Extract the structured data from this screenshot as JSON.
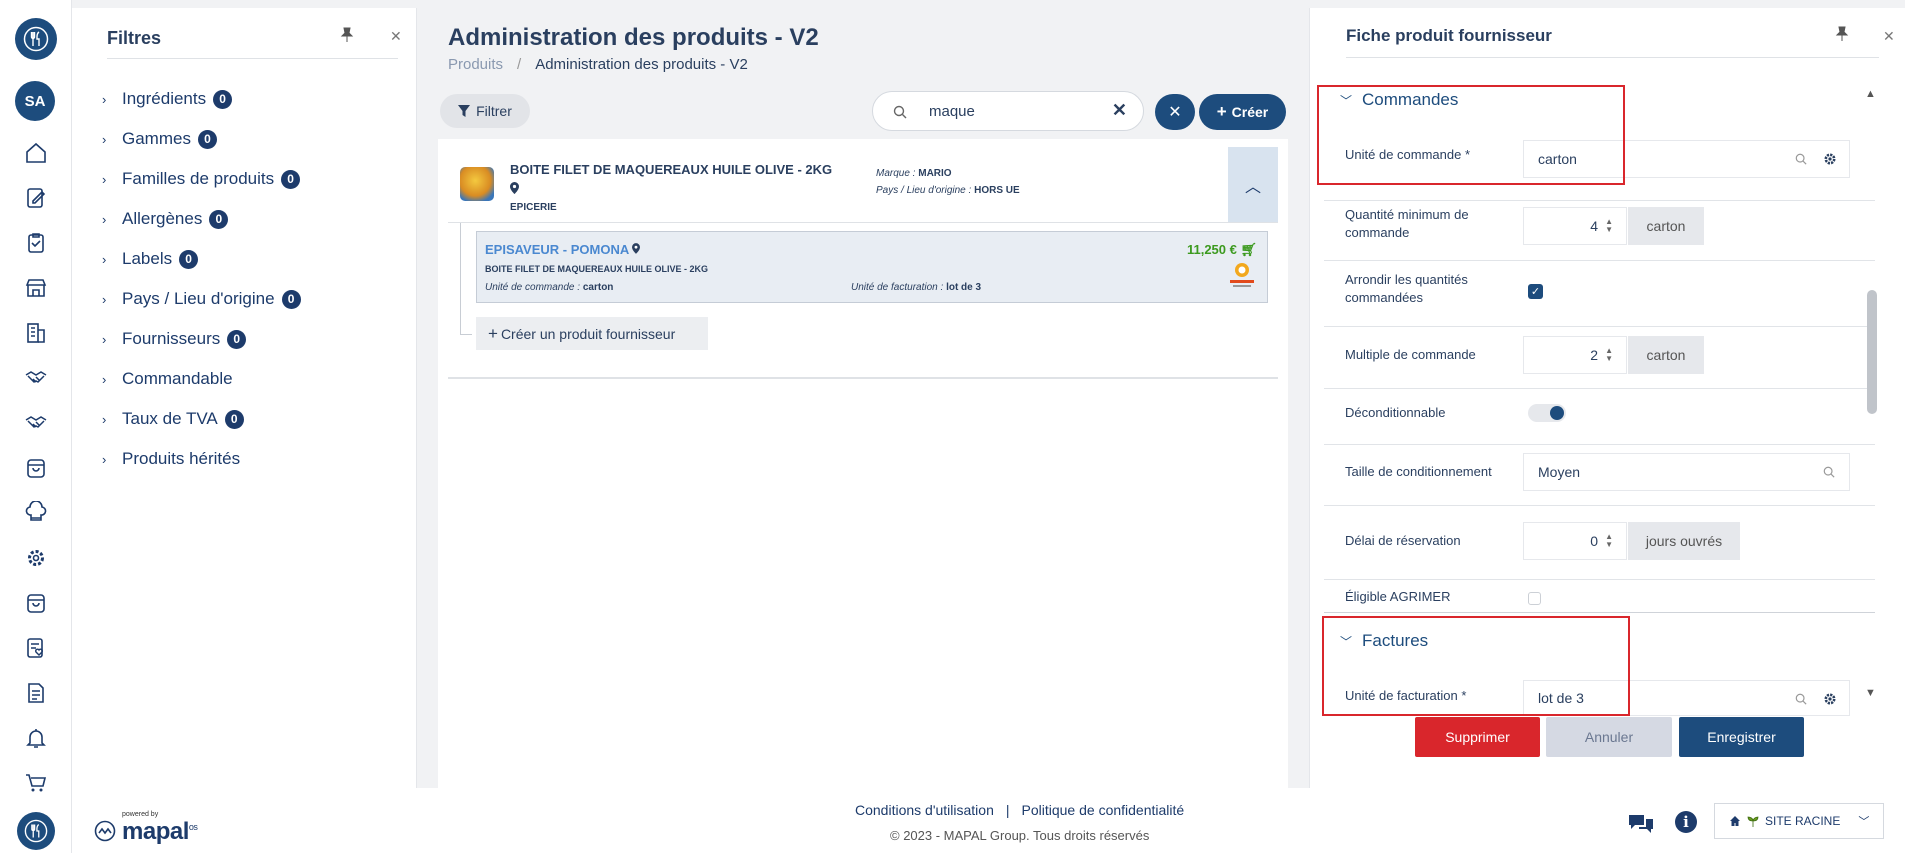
{
  "rail": {
    "avatar": "SA",
    "icons": [
      "home-icon",
      "edit-icon",
      "clipboard-icon",
      "store-icon",
      "building-icon",
      "handshake-icon",
      "handshake-icon",
      "bag-icon",
      "chef-hat-icon",
      "gear-icon",
      "basket-icon",
      "list-heart-icon",
      "document-icon",
      "bell-icon",
      "cart-icon"
    ]
  },
  "filters": {
    "title": "Filtres",
    "items": [
      {
        "label": "Ingrédients",
        "count": "0"
      },
      {
        "label": "Gammes",
        "count": "0"
      },
      {
        "label": "Familles de produits",
        "count": "0"
      },
      {
        "label": "Allergènes",
        "count": "0"
      },
      {
        "label": "Labels",
        "count": "0"
      },
      {
        "label": "Pays / Lieu d'origine",
        "count": "0"
      },
      {
        "label": "Fournisseurs",
        "count": "0"
      },
      {
        "label": "Commandable",
        "count": null
      },
      {
        "label": "Taux de TVA",
        "count": "0"
      },
      {
        "label": "Produits hérités",
        "count": null
      }
    ]
  },
  "main": {
    "title": "Administration des produits - V2",
    "breadcrumb": {
      "root": "Produits",
      "sep": "/",
      "current": "Administration des produits - V2"
    },
    "filter_button": "Filtrer",
    "search_value": "maque",
    "create_button": "Créer",
    "product": {
      "name": "BOITE FILET DE MAQUEREAUX HUILE OLIVE - 2KG",
      "category": "EPICERIE",
      "brand_label": "Marque :",
      "brand_value": "MARIO",
      "origin_label": "Pays / Lieu d'origine :",
      "origin_value": "HORS UE"
    },
    "supplier_product": {
      "supplier": "EPISAVEUR - POMONA",
      "name": "BOITE FILET DE MAQUEREAUX HUILE OLIVE - 2KG",
      "order_unit_label": "Unité de commande :",
      "order_unit_value": "carton",
      "billing_unit_label": "Unité de facturation :",
      "billing_unit_value": "lot de 3",
      "price": "11,250 €"
    },
    "add_supplier_product": "Créer un produit fournisseur"
  },
  "right": {
    "title": "Fiche produit fournisseur",
    "section_orders": "Commandes",
    "order_unit_label": "Unité de commande *",
    "order_unit_value": "carton",
    "min_qty_label": "Quantité minimum de commande",
    "min_qty_value": "4",
    "min_qty_unit": "carton",
    "round_label": "Arrondir les quantités commandées",
    "round_checked": true,
    "multiple_label": "Multiple de commande",
    "multiple_value": "2",
    "multiple_unit": "carton",
    "deconditionable_label": "Déconditionnable",
    "deconditionable_on": true,
    "pack_size_label": "Taille de conditionnement",
    "pack_size_value": "Moyen",
    "booking_delay_label": "Délai de réservation",
    "booking_delay_value": "0",
    "booking_delay_unit": "jours ouvrés",
    "agrimer_label": "Éligible AGRIMER",
    "agrimer_checked": false,
    "section_invoices": "Factures",
    "billing_unit_label": "Unité de facturation *",
    "billing_unit_value": "lot de 3",
    "delete_button": "Supprimer",
    "cancel_button": "Annuler",
    "save_button": "Enregistrer"
  },
  "footer": {
    "powered_by": "powered by",
    "brand": "mapal",
    "brand_suffix": "os",
    "terms_link": "Conditions d'utilisation",
    "separator": "|",
    "privacy_link": "Politique de confidentialité",
    "copyright": "© 2023 - MAPAL Group. Tous droits réservés",
    "site_selector": "SITE RACINE"
  },
  "colors": {
    "primary": "#1d4c7d",
    "danger": "#d9262c",
    "price": "#3c9a1f",
    "supplier_link": "#4a88d0"
  }
}
